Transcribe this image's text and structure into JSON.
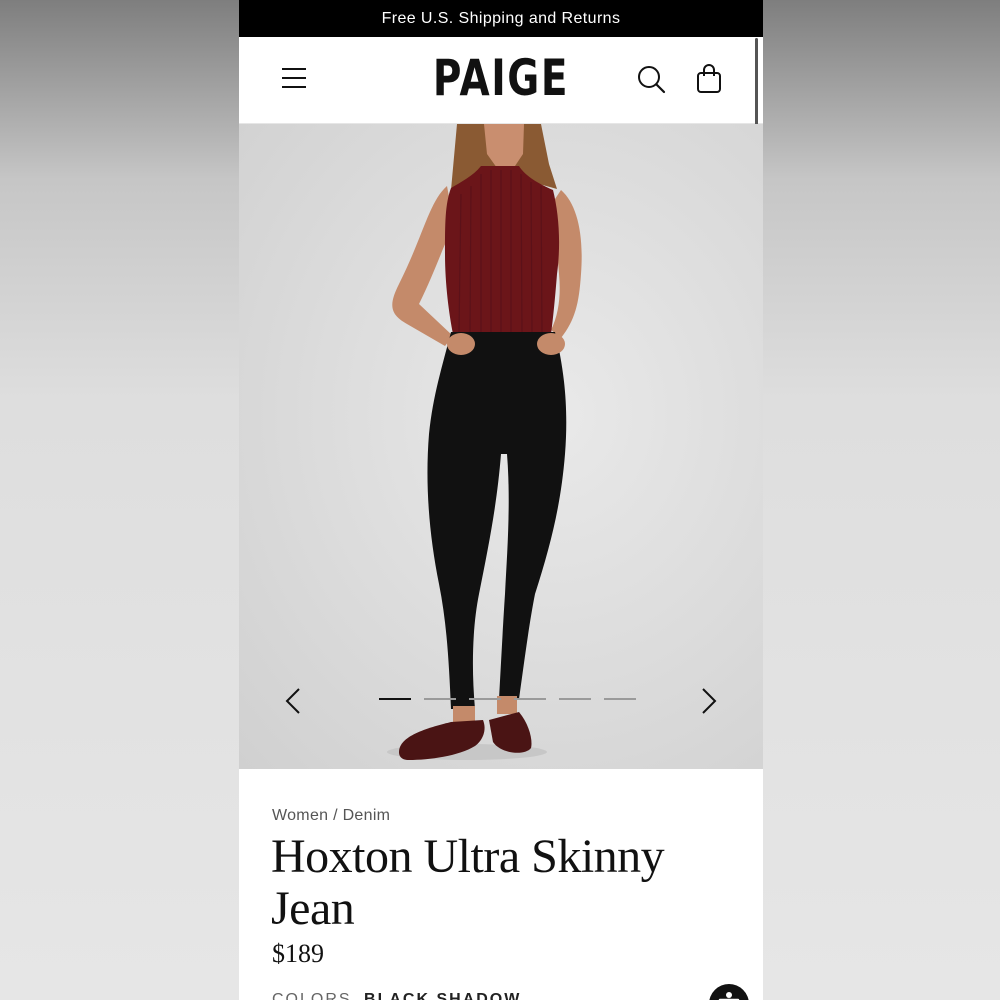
{
  "promo": {
    "text": "Free U.S. Shipping and Returns"
  },
  "header": {
    "logo": "PAIGE",
    "icons": {
      "menu": "hamburger-menu-icon",
      "search": "search-icon",
      "bag": "shopping-bag-icon"
    }
  },
  "carousel": {
    "image_count": 6,
    "active_index": 0
  },
  "product": {
    "breadcrumb": "Women / Denim",
    "title": "Hoxton Ultra Skinny Jean",
    "price": "$189",
    "color_label": "COLORS",
    "color_value": "BLACK SHADOW"
  },
  "colors": {
    "top": "#6b1519",
    "jeans": "#111111",
    "shoes": "#4a1414"
  }
}
